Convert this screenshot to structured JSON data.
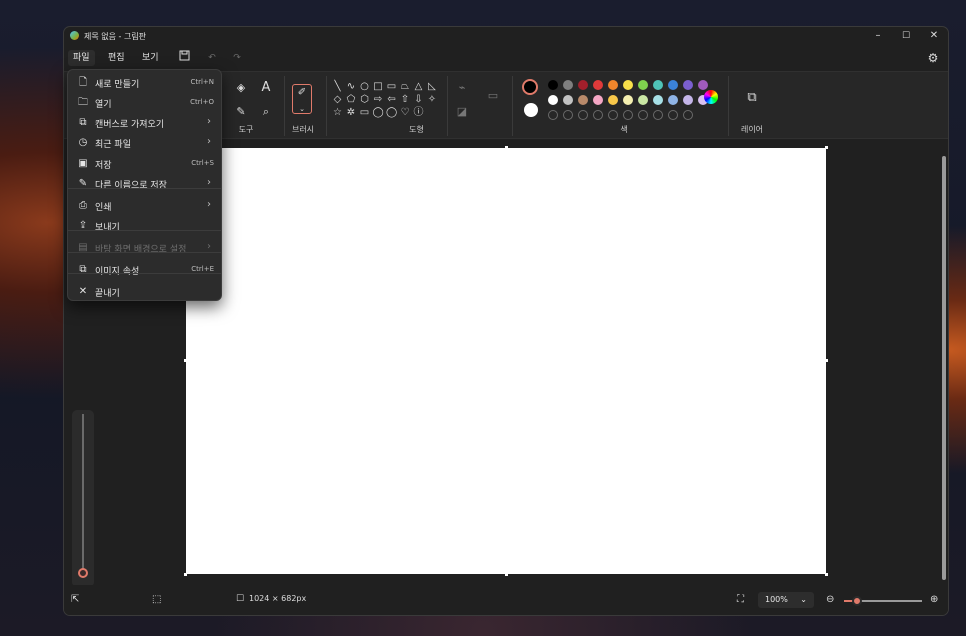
{
  "window": {
    "title": "제목 없음 - 그림판",
    "minimize": "–",
    "maximize": "☐",
    "close": "✕"
  },
  "menubar": {
    "file": "파일",
    "edit": "편집",
    "view": "보기",
    "save_icon": "save-icon",
    "undo_icon": "undo-icon",
    "redo_icon": "redo-icon",
    "settings_icon": "gear-icon"
  },
  "ribbon": {
    "tools_label": "도구",
    "brush_label": "브러시",
    "shapes_label": "도형",
    "colors_label": "색",
    "layers_label": "레이어",
    "shapes": [
      "╲",
      "∿",
      "○",
      "□",
      "▭",
      "⏢",
      "△",
      "◺",
      "◇",
      "⬠",
      "⬡",
      "⇨",
      "⇦",
      "⇧",
      "⇩",
      "✧",
      "☆",
      "✲",
      "▭",
      "◯",
      "◯",
      "♡",
      "ⓘ"
    ],
    "colors_row1": [
      "#000000",
      "#7f7f7f",
      "#a31f2b",
      "#e03a3a",
      "#f0862c",
      "#f8e04a",
      "#7fd24e",
      "#4fc3b7",
      "#3b82d8",
      "#7b5fd0",
      "#a05bbd"
    ],
    "colors_row2": [
      "#ffffff",
      "#c3c3c3",
      "#b98a6a",
      "#f4a6c4",
      "#f9c84a",
      "#f4efb0",
      "#cbe8a4",
      "#a7e0e6",
      "#8fb4e6",
      "#c4b5e8",
      "#d8c0f0"
    ],
    "primary_color": "#000000",
    "secondary_color": "#ffffff"
  },
  "file_menu": {
    "items": [
      {
        "label": "새로 만들기",
        "shortcut": "Ctrl+N",
        "icon": "new-file-icon",
        "glyph": "🗋"
      },
      {
        "label": "열기",
        "shortcut": "Ctrl+O",
        "icon": "folder-icon",
        "glyph": "🗀"
      },
      {
        "label": "캔버스로 가져오기",
        "arrow": "›",
        "icon": "import-icon",
        "glyph": "⧉"
      },
      {
        "label": "최근 파일",
        "arrow": "›",
        "icon": "clock-icon",
        "glyph": "◷"
      },
      {
        "label": "저장",
        "shortcut": "Ctrl+S",
        "icon": "save-icon",
        "glyph": "▣"
      },
      {
        "label": "다른 이름으로 저장",
        "arrow": "›",
        "icon": "save-as-icon",
        "glyph": "✎"
      },
      {
        "label": "인쇄",
        "arrow": "›",
        "icon": "printer-icon",
        "glyph": "⎙"
      },
      {
        "label": "보내기",
        "icon": "share-icon",
        "glyph": "⇪"
      },
      {
        "label": "바탕 화면 배경으로 설정",
        "arrow": "›",
        "icon": "desktop-icon",
        "glyph": "▤",
        "disabled": true
      },
      {
        "label": "이미지 속성",
        "shortcut": "Ctrl+E",
        "icon": "image-properties-icon",
        "glyph": "⧉"
      },
      {
        "label": "끝내기",
        "icon": "close-icon",
        "glyph": "✕"
      }
    ]
  },
  "status": {
    "canvas_size": "1024 × 682px",
    "zoom": "100%",
    "zoom_value": 0.17
  }
}
